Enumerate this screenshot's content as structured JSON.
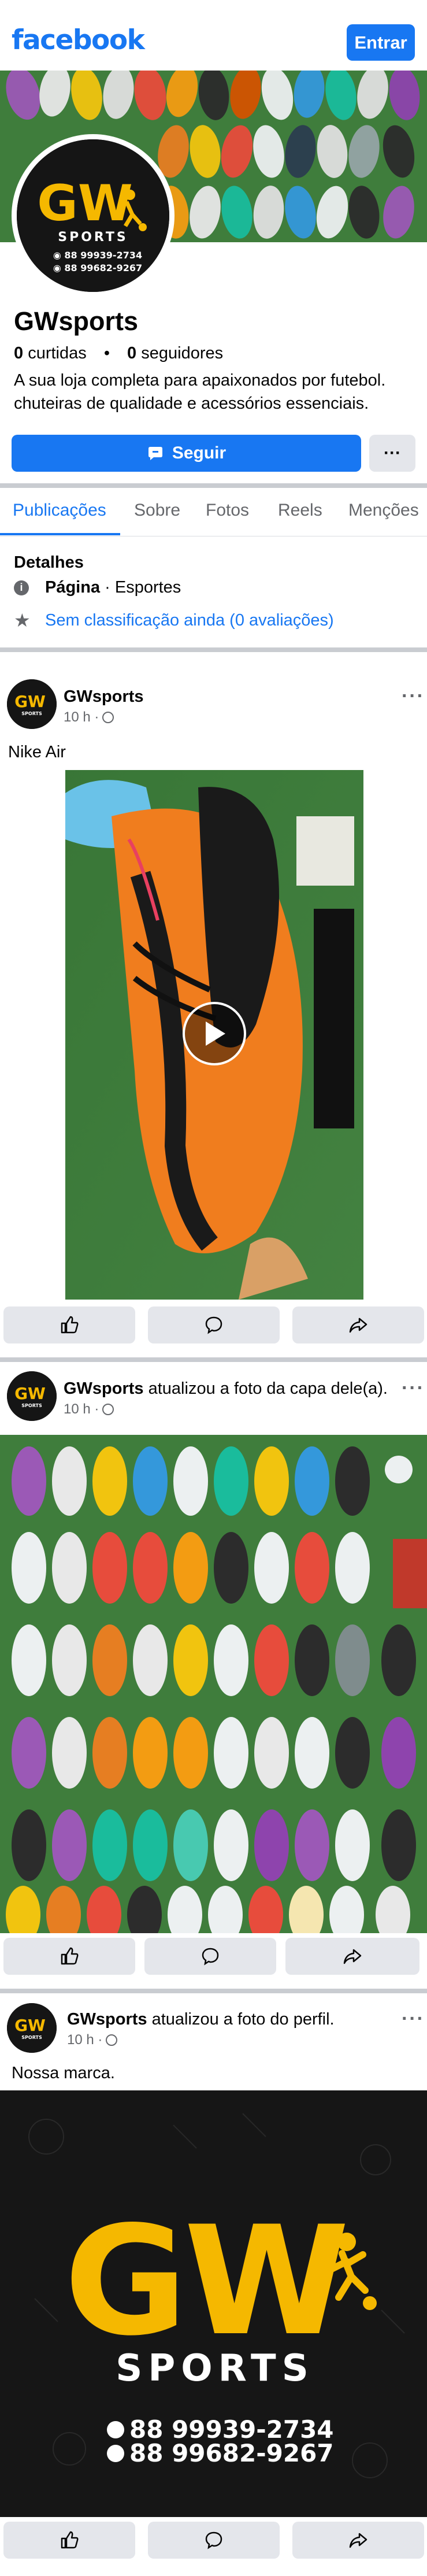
{
  "header": {
    "brand": "facebook",
    "login_label": "Entrar"
  },
  "colors": {
    "brand_blue": "#1877f2",
    "logo_yellow": "#f5b800",
    "grass_green": "#3f7d3c"
  },
  "avatar_logo": {
    "mark": "GW",
    "sub": "SPORTS",
    "phones": [
      "88 99939-2734",
      "88 99682-9267"
    ]
  },
  "profile": {
    "name": "GWsports",
    "likes_count": "0",
    "likes_label": "curtidas",
    "dot": "•",
    "followers_count": "0",
    "followers_label": "seguidores",
    "bio": "A sua loja completa para apaixonados por futebol. chuteiras de qualidade e acessórios essenciais.",
    "follow_label": "Seguir",
    "more_label": "···"
  },
  "tabs": [
    {
      "label": "Publicações",
      "active": true
    },
    {
      "label": "Sobre"
    },
    {
      "label": "Fotos"
    },
    {
      "label": "Reels"
    },
    {
      "label": "Menções"
    }
  ],
  "details": {
    "title": "Detalhes",
    "page_bold": "Página",
    "page_rest": " · Esportes",
    "rating": "Sem classificação ainda (0 avaliações)"
  },
  "posts": [
    {
      "author": "GWsports",
      "action": "",
      "time": "10 h · ",
      "text": "Nike Air"
    },
    {
      "author": "GWsports",
      "action": " atualizou a foto da capa dele(a).",
      "time": "10 h · ",
      "text": ""
    },
    {
      "author": "GWsports",
      "action": " atualizou a foto do perfil.",
      "time": "10 h · ",
      "text": "Nossa marca."
    }
  ],
  "post_more": "···"
}
